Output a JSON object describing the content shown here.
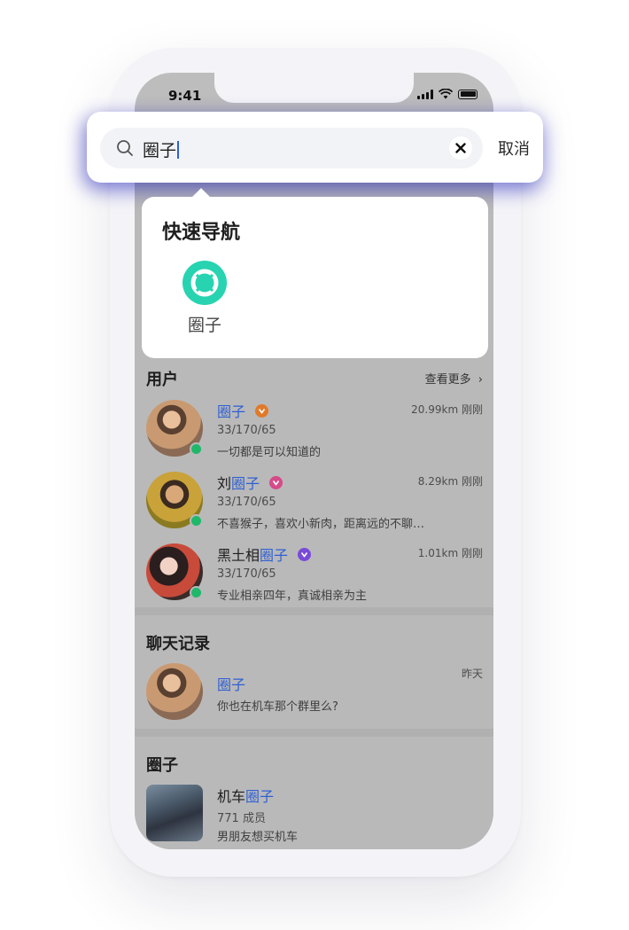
{
  "status_bar": {
    "time": "9:41"
  },
  "search": {
    "query": "圈子",
    "cancel_label": "取消"
  },
  "quick_nav": {
    "title": "快速导航",
    "items": [
      {
        "label": "圈子",
        "icon": "circle-lifebuoy-icon",
        "color": "#27d3b0"
      }
    ]
  },
  "users": {
    "title": "用户",
    "more_label": "查看更多",
    "items": [
      {
        "name_prefix": "",
        "name_highlight": "圈子",
        "badge_color": "#e07a2a",
        "stats": "33/170/65",
        "bio": "一切都是可以知道的",
        "distance": "20.99km",
        "time": "刚刚"
      },
      {
        "name_prefix": "刘",
        "name_highlight": "圈子",
        "badge_color": "#d64a8a",
        "stats": "33/170/65",
        "bio": "不喜猴子，喜欢小新肉，距离远的不聊…",
        "distance": "8.29km",
        "time": "刚刚"
      },
      {
        "name_prefix": "黑土相",
        "name_highlight": "圈子",
        "badge_color": "#7a4ad8",
        "stats": "33/170/65",
        "bio": "专业相亲四年，真诚相亲为主",
        "distance": "1.01km",
        "time": "刚刚"
      }
    ]
  },
  "chats": {
    "title": "聊天记录",
    "items": [
      {
        "name_highlight": "圈子",
        "message": "你也在机车那个群里么?",
        "time": "昨天"
      }
    ]
  },
  "groups": {
    "title": "圈子",
    "items": [
      {
        "name_prefix": "机车",
        "name_highlight": "圈子",
        "members": "771 成员",
        "desc": "男朋友想买机车"
      }
    ]
  },
  "colors": {
    "highlight": "#2f5fd4",
    "online": "#1fb86a",
    "accent": "#27d3b0"
  }
}
